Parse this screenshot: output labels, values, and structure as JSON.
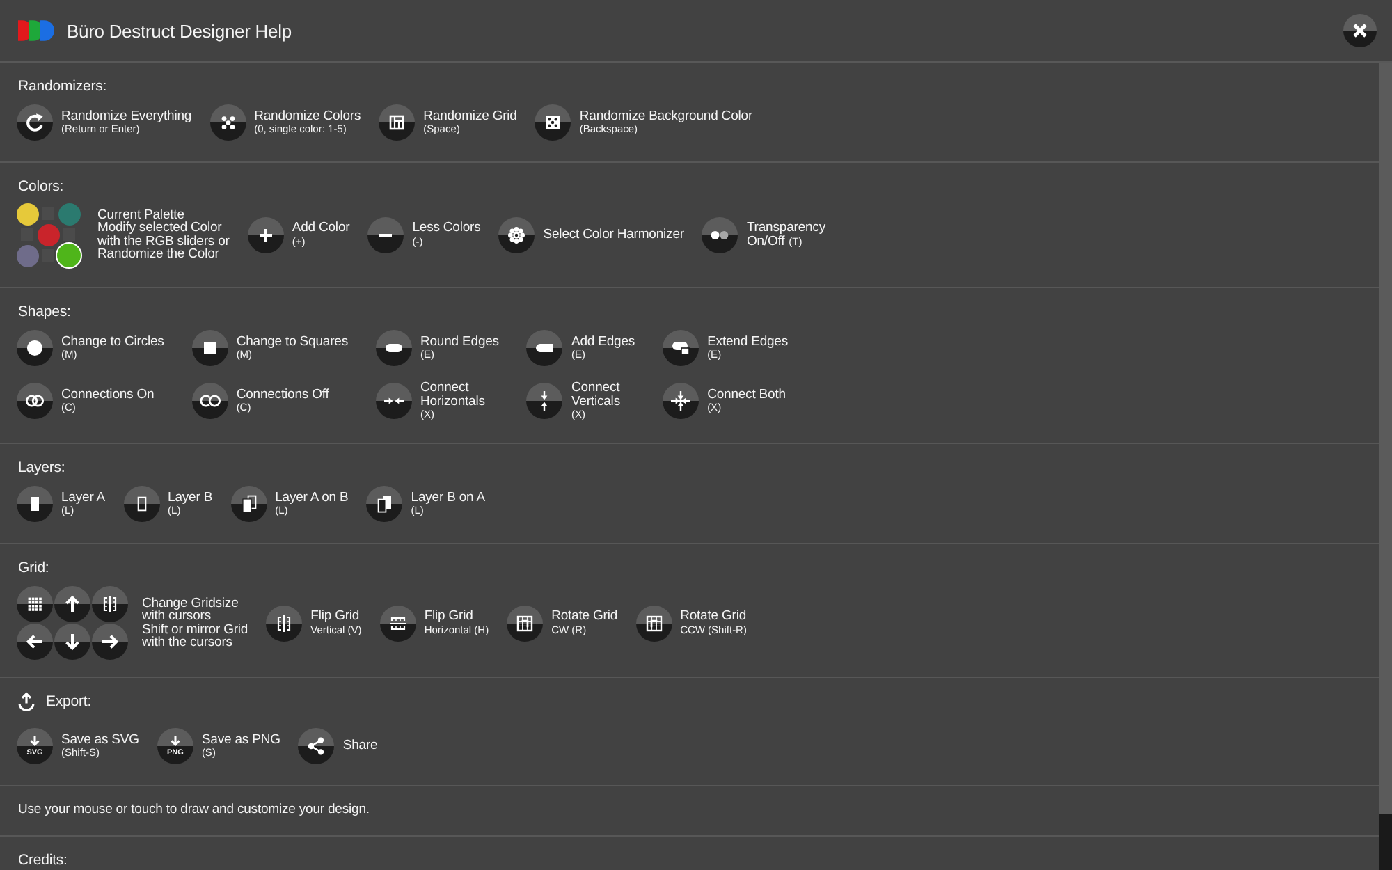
{
  "window": {
    "title": "Büro Destruct Designer Help"
  },
  "sections": [
    {
      "kind": "randomizers",
      "heading": "Randomizers:",
      "rows": [
        [
          {
            "label": "Randomize Everything",
            "hint": "(Return or Enter)"
          },
          {
            "label": "Randomize Colors",
            "hint": "(0, single color: 1-5)"
          },
          {
            "label": "Randomize Grid",
            "hint": "(Space)"
          },
          {
            "label": "Randomize Background Color",
            "hint": "(Backspace)"
          }
        ]
      ]
    },
    {
      "kind": "colors",
      "heading": "Colors:",
      "palette": {
        "colors": [
          {
            "color": "#e6c93a",
            "selected": false
          },
          {
            "color": "#2b7a6f",
            "selected": false
          },
          {
            "color": "#c9242b",
            "selected": false
          },
          {
            "color": "#6f6c8a",
            "selected": false
          },
          {
            "color": "#4fb51a",
            "selected": true
          }
        ],
        "label": "Current Palette",
        "description": "Modify selected Color\nwith the RGB sliders or\nRandomize the Color"
      },
      "rows": [
        [
          {
            "label": "Add Color",
            "hint": "(+)"
          },
          {
            "label": "Less Colors",
            "hint": "(-)"
          },
          {
            "label": "Select Color Harmonizer"
          },
          {
            "label": "Transparency\nOn/Off",
            "hint": "(T)",
            "hint_inline": true
          }
        ]
      ]
    },
    {
      "kind": "shapes",
      "heading": "Shapes:",
      "rows": [
        [
          {
            "label": "Change to Circles",
            "hint": "(M)"
          },
          {
            "label": "Change to Squares",
            "hint": "(M)"
          },
          {
            "label": "Round Edges",
            "hint": "(E)"
          },
          {
            "label": "Add Edges",
            "hint": "(E)"
          },
          {
            "label": "Extend Edges",
            "hint": "(E)"
          }
        ],
        [
          {
            "label": "Connections On",
            "hint": "(C)"
          },
          {
            "label": "Connections Off",
            "hint": "(C)"
          },
          {
            "label": "Connect\nHorizontals",
            "hint": "(X)"
          },
          {
            "label": "Connect\nVerticals",
            "hint": "(X)"
          },
          {
            "label": "Connect Both",
            "hint": "(X)"
          }
        ]
      ]
    },
    {
      "kind": "layers",
      "heading": "Layers:",
      "rows": [
        [
          {
            "label": "Layer A",
            "hint": "(L)"
          },
          {
            "label": "Layer B",
            "hint": "(L)"
          },
          {
            "label": "Layer A on B",
            "hint": "(L)"
          },
          {
            "label": "Layer B on A",
            "hint": "(L)"
          }
        ]
      ]
    },
    {
      "kind": "grid",
      "heading": "Grid:",
      "pad_text": "Change Gridsize\nwith cursors\nShift or mirror Grid\nwith the cursors",
      "rows": [
        [
          {
            "label": "Flip Grid",
            "hint": "Vertical (V)"
          },
          {
            "label": "Flip Grid",
            "hint": "Horizontal (H)"
          },
          {
            "label": "Rotate Grid",
            "hint": "CW (R)"
          },
          {
            "label": "Rotate Grid",
            "hint": "CCW (Shift-R)"
          }
        ]
      ]
    },
    {
      "kind": "export",
      "heading": "Export:",
      "rows": [
        [
          {
            "label": "Save as SVG",
            "hint": "(Shift-S)",
            "badge": "SVG"
          },
          {
            "label": "Save as PNG",
            "hint": "(S)",
            "badge": "PNG"
          },
          {
            "label": "Share"
          }
        ]
      ]
    },
    {
      "kind": "note",
      "text": "Use your mouse or touch to draw and customize your design."
    },
    {
      "kind": "credits",
      "heading": "Credits:"
    }
  ]
}
